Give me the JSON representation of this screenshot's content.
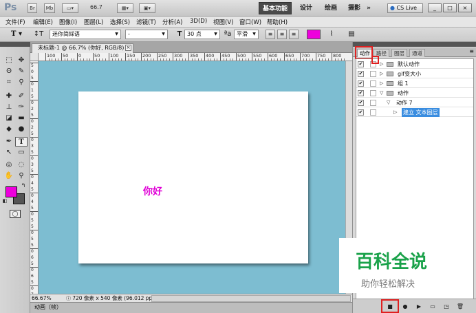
{
  "app": {
    "logo": "Ps",
    "zoom_menu": "66.7",
    "workspaces": [
      "基本功能",
      "设计",
      "绘画",
      "摄影",
      "»"
    ],
    "cs_live": "CS Live",
    "window_controls": [
      "_",
      "□",
      "×"
    ]
  },
  "menu": [
    "文件(F)",
    "编辑(E)",
    "图像(I)",
    "图层(L)",
    "选择(S)",
    "滤镜(T)",
    "分析(A)",
    "3D(D)",
    "视图(V)",
    "窗口(W)",
    "帮助(H)"
  ],
  "options": {
    "font_family": "迷你简綵语",
    "font_style": "-",
    "font_size": "30 点",
    "aa_label": "a",
    "aa_mode": "平滑",
    "text_color": "#ee00dd"
  },
  "document": {
    "tab_title": "未标题-1 @ 66.7% (你好, RGB/8) *",
    "canvas_text": "你好",
    "ruler_top": [
      "100",
      "50",
      "0",
      "50",
      "100",
      "150",
      "200",
      "250",
      "300",
      "350",
      "400",
      "450",
      "500",
      "550",
      "600",
      "650",
      "700",
      "750",
      "800"
    ],
    "ruler_left": [
      "5",
      "0",
      "5",
      "0",
      "1",
      "5",
      "0",
      "2",
      "5",
      "0",
      "2",
      "5",
      "0",
      "3",
      "5",
      "0",
      "3",
      "5",
      "0",
      "4",
      "5",
      "0",
      "4",
      "5",
      "0",
      "5",
      "5",
      "0",
      "5",
      "5",
      "0",
      "6",
      "5",
      "0",
      "6",
      "5",
      "0",
      "7"
    ],
    "status_zoom": "66.67%",
    "status_info": "720 像素 x 540 像素 (96.012 ppi)",
    "animation_label": "动画（帧）"
  },
  "colors": {
    "foreground": "#ee00dd",
    "background": "#555555",
    "canvas_bg": "#7dbdd1"
  },
  "panel": {
    "tabs": [
      "动作",
      "路径",
      "图层",
      "通道"
    ],
    "actions": [
      {
        "label": "默认动作",
        "level": 0,
        "expanded": false,
        "folder": true
      },
      {
        "label": "gif变大小",
        "level": 0,
        "expanded": false,
        "folder": true
      },
      {
        "label": "组 1",
        "level": 0,
        "expanded": false,
        "folder": true
      },
      {
        "label": "动作",
        "level": 0,
        "expanded": true,
        "folder": true
      },
      {
        "label": "动作 7",
        "level": 1,
        "expanded": true,
        "folder": false
      },
      {
        "label": "建立 文本图层",
        "level": 2,
        "expanded": false,
        "folder": false,
        "selected": true
      }
    ]
  },
  "watermark": {
    "title": "百科全说",
    "subtitle": "助你轻松解决"
  }
}
